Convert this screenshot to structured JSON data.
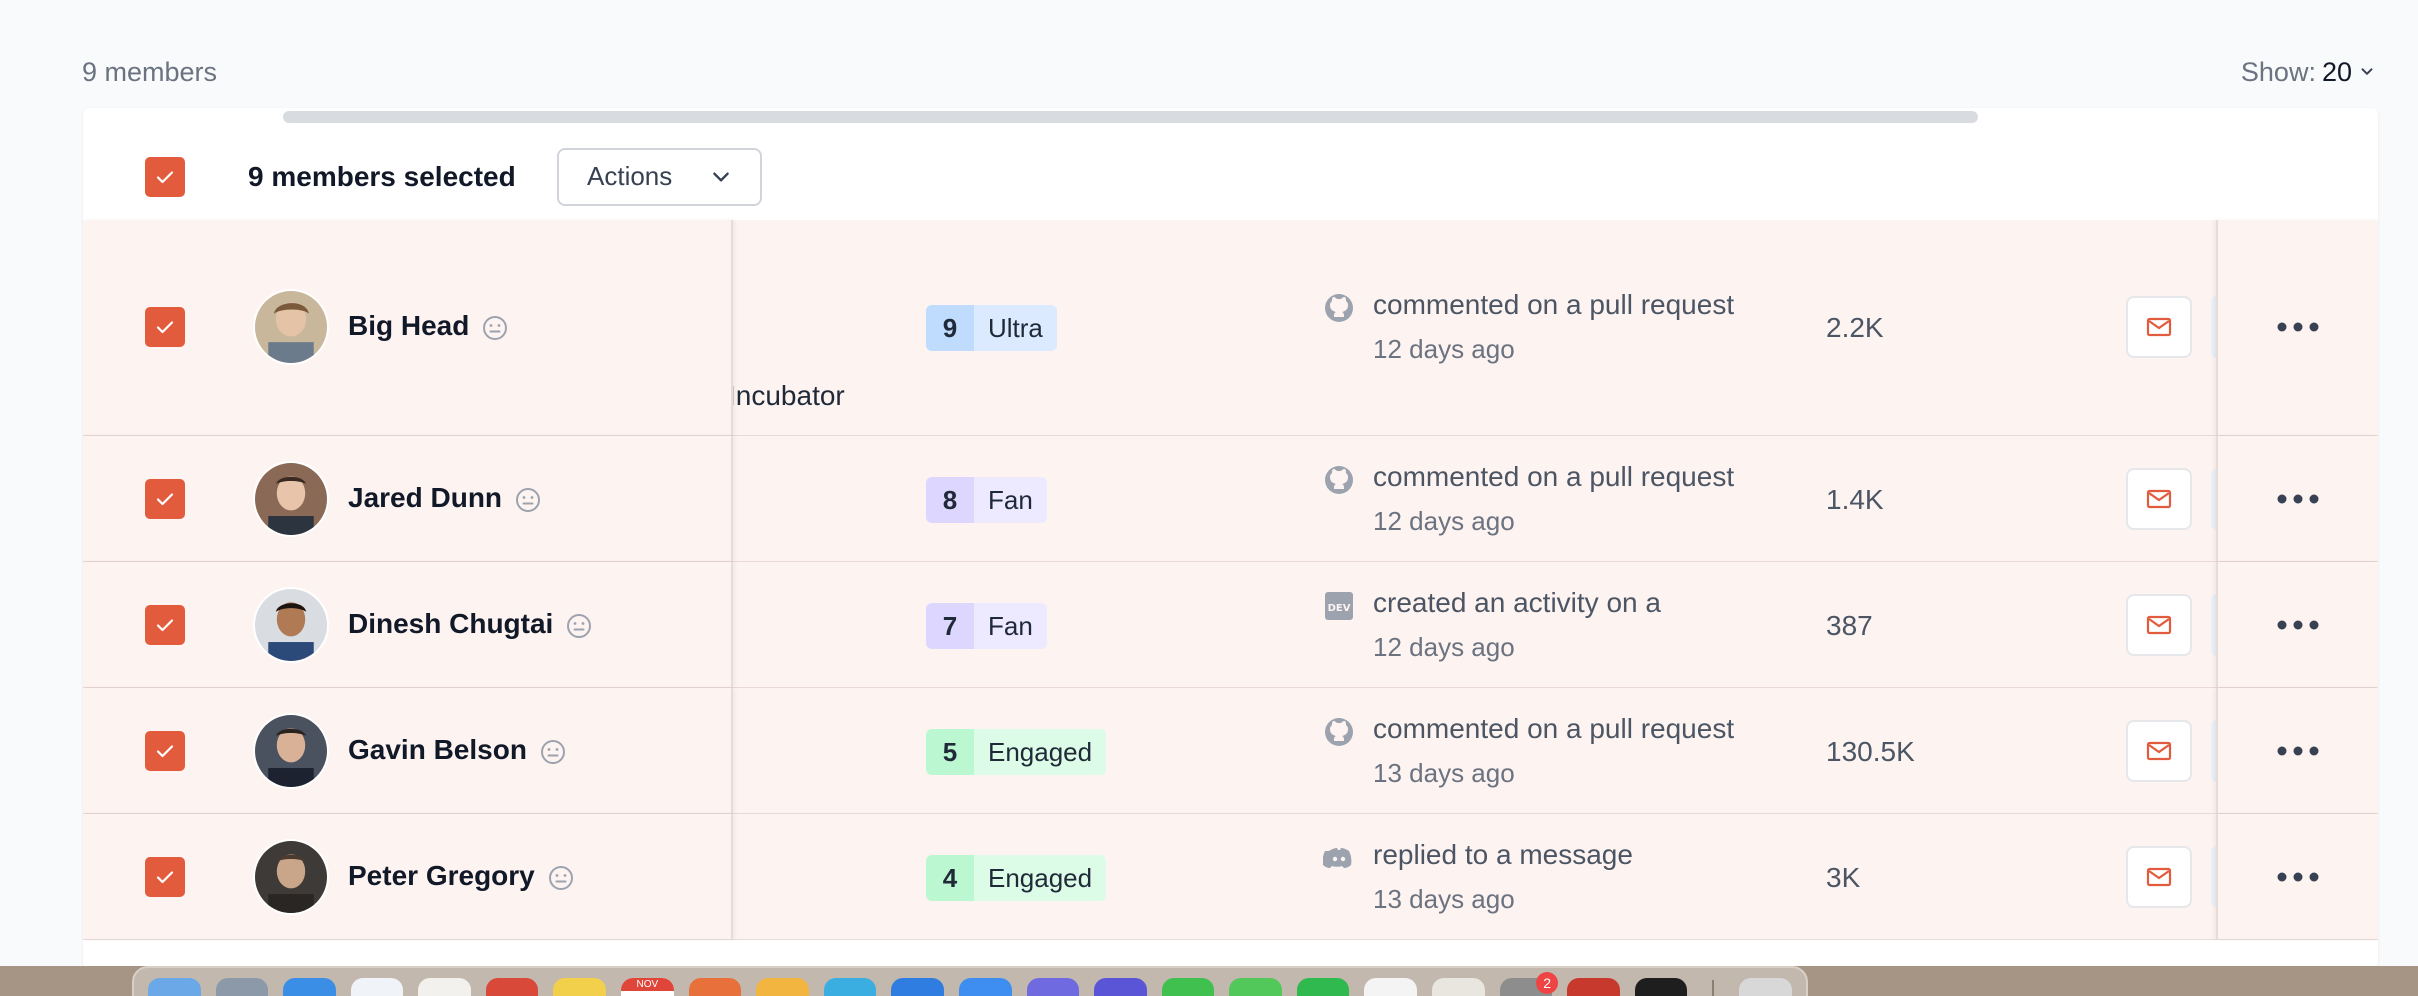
{
  "toolbar": {
    "member_count": "9 members",
    "show_label": "Show:",
    "show_value": "20"
  },
  "bulk": {
    "selected_label": "9 members selected",
    "actions_label": "Actions"
  },
  "rows": [
    {
      "name": "Big Head",
      "org": "Incubator",
      "level_num": "9",
      "level_label": "Ultra",
      "activity_icon": "github-icon",
      "activity": "commented on a pull request",
      "time": "12 days ago",
      "metric": "2.2K"
    },
    {
      "name": "Jared Dunn",
      "level_num": "8",
      "level_label": "Fan",
      "activity_icon": "github-icon",
      "activity": "commented on a pull request",
      "time": "12 days ago",
      "metric": "1.4K"
    },
    {
      "name": "Dinesh Chugtai",
      "level_num": "7",
      "level_label": "Fan",
      "activity_icon": "dev-icon",
      "activity": "created an activity on a",
      "time": "12 days ago",
      "metric": "387"
    },
    {
      "name": "Gavin Belson",
      "level_num": "5",
      "level_label": "Engaged",
      "activity_icon": "github-icon",
      "activity": "commented on a pull request",
      "time": "13 days ago",
      "metric": "130.5K"
    },
    {
      "name": "Peter Gregory",
      "level_num": "4",
      "level_label": "Engaged",
      "activity_icon": "discord-icon",
      "activity": "replied to a message",
      "time": "13 days ago",
      "metric": "3K"
    }
  ],
  "dock": {
    "badge_count": "2",
    "calendar_month": "NOV"
  },
  "colors": {
    "accent": "#e35b3d",
    "row_bg": "#fdf3f1"
  }
}
